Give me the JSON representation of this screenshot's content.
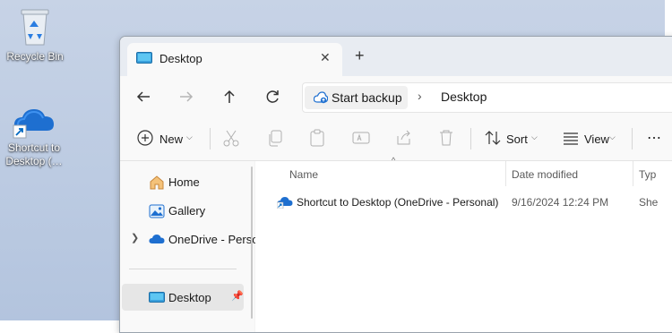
{
  "desktop": {
    "icons": [
      {
        "label": "Recycle Bin",
        "icon": "recycle-bin-icon"
      },
      {
        "label_line1": "Shortcut to",
        "label_line2": "Desktop (…",
        "icon": "onedrive-cloud-shortcut-icon"
      }
    ]
  },
  "window": {
    "tab": {
      "title": "Desktop",
      "close": "✕",
      "new_tab": "+"
    },
    "nav": {
      "back_icon": "back-arrow-icon",
      "forward_icon": "forward-arrow-icon",
      "up_icon": "up-arrow-icon",
      "refresh_icon": "refresh-icon"
    },
    "breadcrumb": {
      "backup_label": "Start backup",
      "separator": "›",
      "location": "Desktop"
    },
    "commands": {
      "new_label": "New",
      "sort_label": "Sort",
      "view_label": "View",
      "more": "⋯",
      "icons": [
        "cut-icon",
        "copy-icon",
        "paste-icon",
        "rename-icon",
        "share-icon",
        "delete-icon"
      ]
    },
    "sidebar": {
      "items": [
        {
          "label": "Home",
          "icon": "home-icon"
        },
        {
          "label": "Gallery",
          "icon": "gallery-icon"
        },
        {
          "label": "OneDrive - Perso",
          "icon": "onedrive-icon",
          "expandable": true
        },
        {
          "label": "Desktop",
          "icon": "desktop-folder-icon",
          "selected": true,
          "pinned": true
        }
      ]
    },
    "file_list": {
      "columns": {
        "name": "Name",
        "date": "Date modified",
        "type": "Typ"
      },
      "sort_indicator": "^",
      "rows": [
        {
          "name": "Shortcut to Desktop (OneDrive - Personal)",
          "date": "9/16/2024 12:24 PM",
          "type": "She"
        }
      ]
    }
  },
  "colors": {
    "accent": "#0067c0",
    "onedrive": "#1e6fd0",
    "selected_bg": "#e6e6e6"
  }
}
